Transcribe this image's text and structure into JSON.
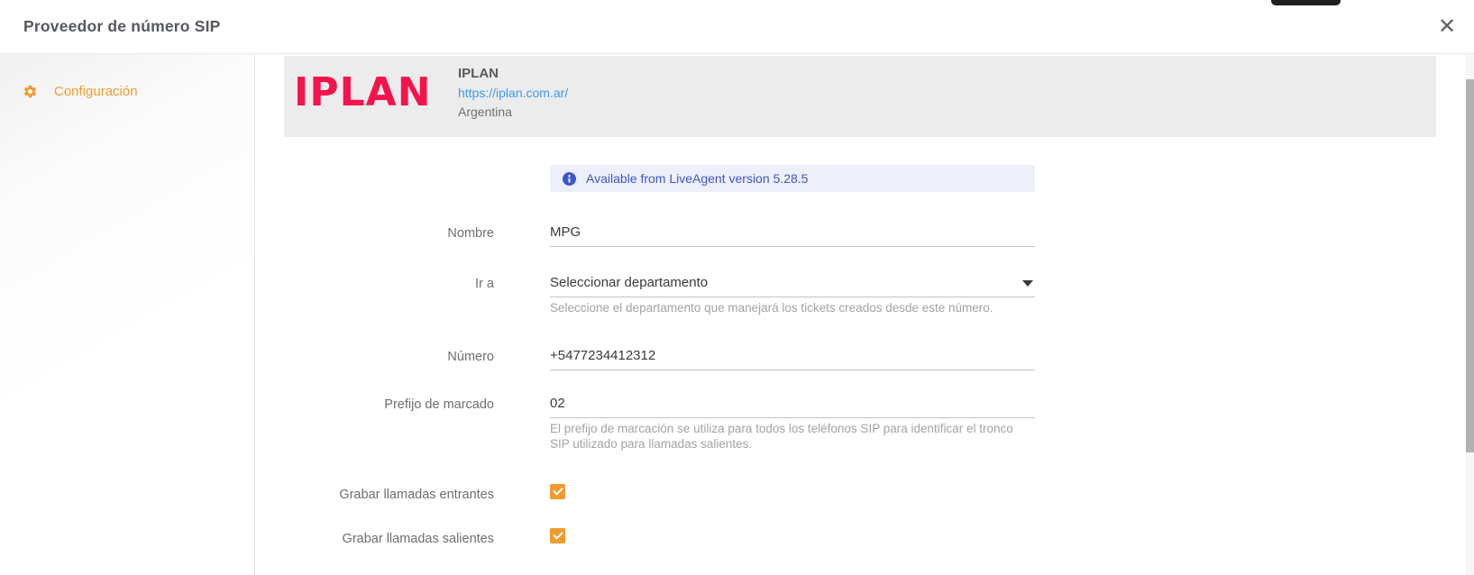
{
  "modal": {
    "title": "Proveedor de número SIP",
    "close_icon": "✕"
  },
  "sidebar": {
    "items": [
      {
        "label": "Configuración",
        "icon": "gear-icon"
      }
    ]
  },
  "provider": {
    "logo_text": "IPLAN",
    "name": "IPLAN",
    "url": "https://iplan.com.ar/",
    "country": "Argentina"
  },
  "banner": {
    "icon": "info-icon",
    "text": "Available from LiveAgent version 5.28.5"
  },
  "form": {
    "name_label": "Nombre",
    "name_value": "MPG",
    "department_label": "Ir a",
    "department_value": "Seleccionar departamento",
    "department_help": "Seleccione el departamento que manejará los tickets creados desde este número.",
    "number_label": "Número",
    "number_value": "+5477234412312",
    "prefix_label": "Prefijo de marcado",
    "prefix_value": "02",
    "prefix_help": "El prefijo de marcación se utiliza para todos los teléfonos SIP para identificar el tronco SIP utilizado para llamadas salientes.",
    "record_incoming_label": "Grabar llamadas entrantes",
    "record_incoming_checked": true,
    "record_outgoing_label": "Grabar llamadas salientes",
    "record_outgoing_checked": true
  },
  "colors": {
    "accent_orange": "#f09b2f",
    "brand_pink": "#f5134b",
    "link_blue": "#3b9bef",
    "info_blue": "#3e56c8"
  }
}
